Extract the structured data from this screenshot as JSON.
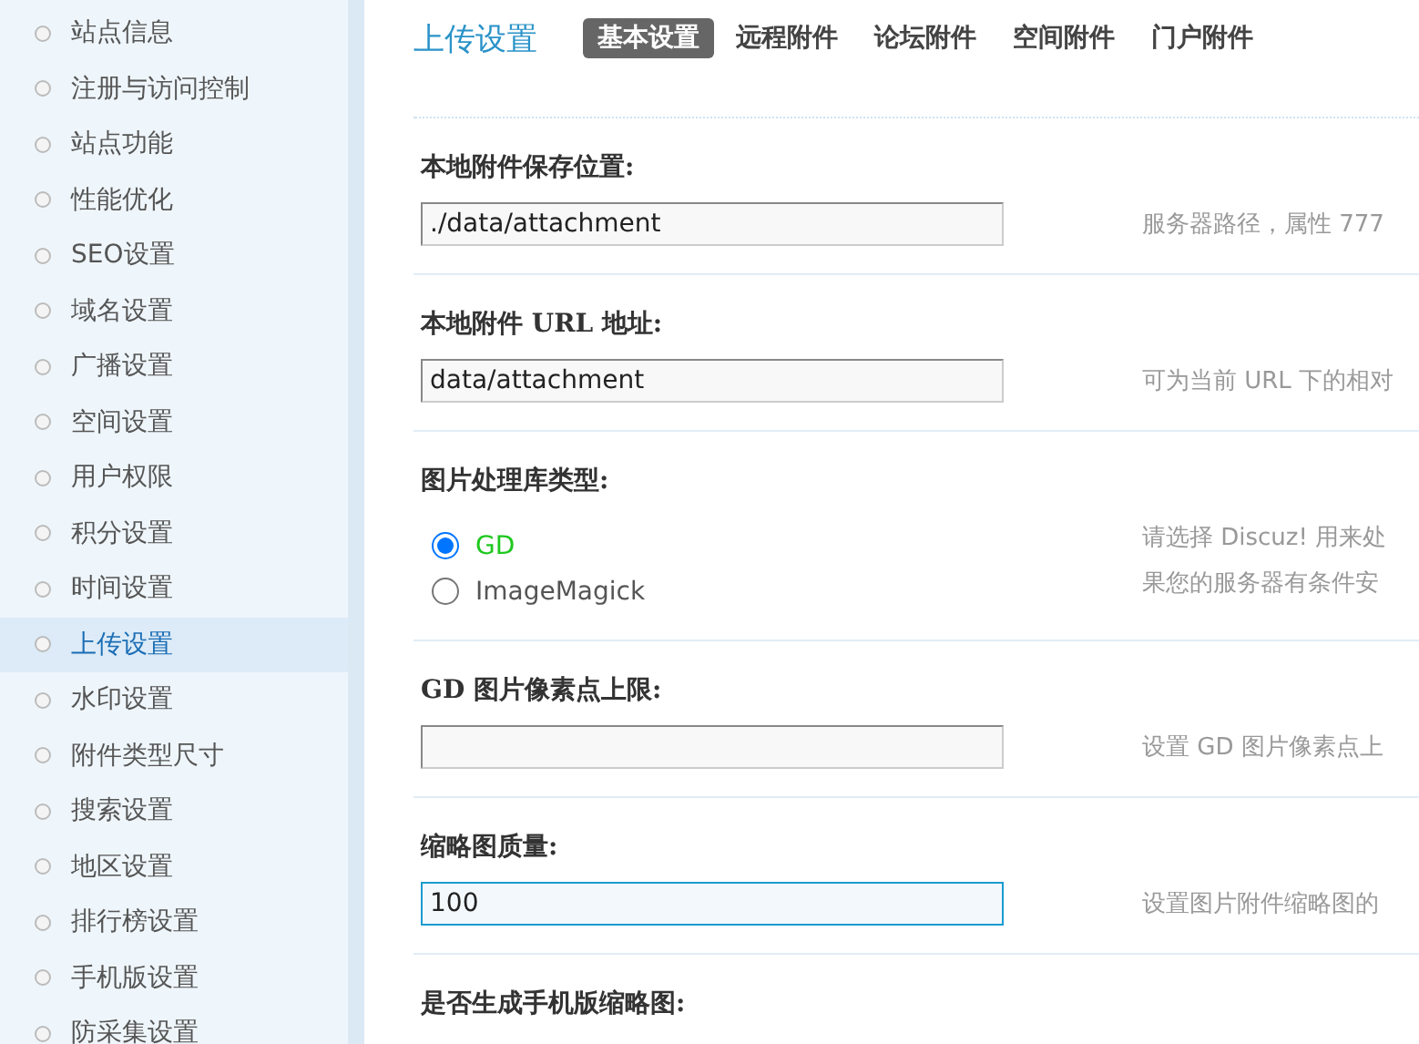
{
  "sidebar": {
    "items": [
      {
        "label": "站点信息",
        "selected": false
      },
      {
        "label": "注册与访问控制",
        "selected": false
      },
      {
        "label": "站点功能",
        "selected": false
      },
      {
        "label": "性能优化",
        "selected": false
      },
      {
        "label": "SEO设置",
        "selected": false
      },
      {
        "label": "域名设置",
        "selected": false
      },
      {
        "label": "广播设置",
        "selected": false
      },
      {
        "label": "空间设置",
        "selected": false
      },
      {
        "label": "用户权限",
        "selected": false
      },
      {
        "label": "积分设置",
        "selected": false
      },
      {
        "label": "时间设置",
        "selected": false
      },
      {
        "label": "上传设置",
        "selected": true
      },
      {
        "label": "水印设置",
        "selected": false
      },
      {
        "label": "附件类型尺寸",
        "selected": false
      },
      {
        "label": "搜索设置",
        "selected": false
      },
      {
        "label": "地区设置",
        "selected": false
      },
      {
        "label": "排行榜设置",
        "selected": false
      },
      {
        "label": "手机版设置",
        "selected": false
      },
      {
        "label": "防采集设置",
        "selected": false
      }
    ]
  },
  "page_title": "上传设置",
  "tabs": [
    {
      "label": "基本设置",
      "selected": true
    },
    {
      "label": "远程附件",
      "selected": false
    },
    {
      "label": "论坛附件",
      "selected": false
    },
    {
      "label": "空间附件",
      "selected": false
    },
    {
      "label": "门户附件",
      "selected": false
    }
  ],
  "settings": [
    {
      "kind": "text",
      "label": "本地附件保存位置:",
      "value": "./data/attachment",
      "focused": false,
      "hint": [
        "服务器路径，属性 777"
      ]
    },
    {
      "kind": "text",
      "label": "本地附件 URL 地址:",
      "value": "data/attachment",
      "focused": false,
      "hint": [
        "可为当前 URL 下的相对"
      ]
    },
    {
      "kind": "radio",
      "label": "图片处理库类型:",
      "options": [
        {
          "label": "GD",
          "selected": true
        },
        {
          "label": "ImageMagick",
          "selected": false
        }
      ],
      "hint": [
        "请选择 Discuz! 用来处",
        "果您的服务器有条件安"
      ]
    },
    {
      "kind": "text",
      "label": "GD 图片像素点上限:",
      "focused": false,
      "hint": [
        "设置 GD 图片像素点上"
      ]
    },
    {
      "kind": "text",
      "label": "缩略图质量:",
      "value": "100",
      "focused": true,
      "hint": [
        "设置图片附件缩略图的"
      ]
    },
    {
      "kind": "heading",
      "label": "是否生成手机版缩略图:"
    }
  ]
}
